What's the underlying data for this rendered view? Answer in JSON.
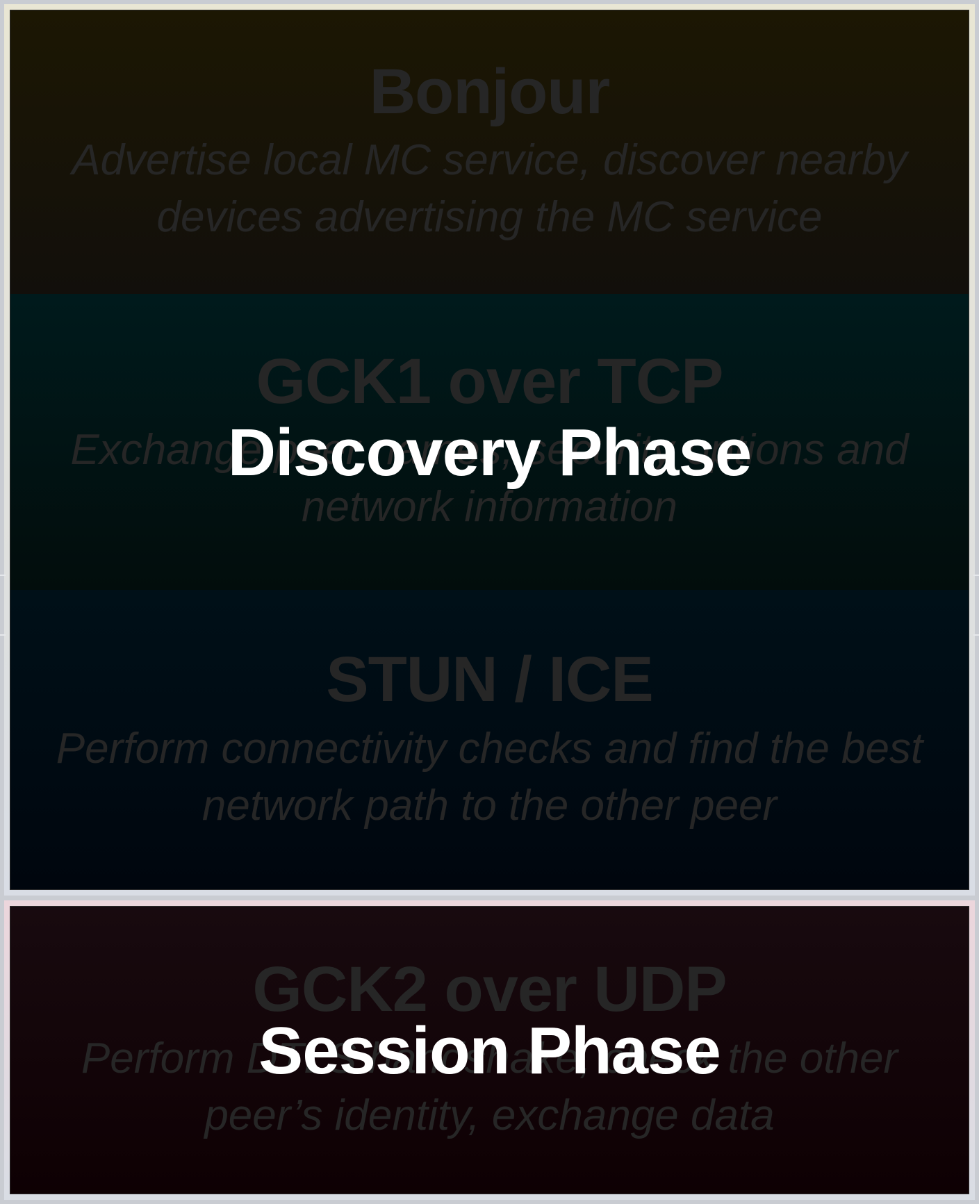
{
  "layers": {
    "bonjour": {
      "title": "Bonjour",
      "description": "Advertise local MC service, discover nearby devices advertising the MC service"
    },
    "gck1": {
      "title": "GCK1 over TCP",
      "description": "Exchange peer names, security options and network information"
    },
    "stun": {
      "title": "STUN / ICE",
      "description": "Perform connectivity checks and find the best network path to the other peer"
    },
    "gck2": {
      "title": "GCK2 over UDP",
      "description": "Perform DTLS handshake, check the other peer’s identity, exchange data"
    }
  },
  "phases": {
    "discovery": "Discovery Phase",
    "session": "Session Phase"
  },
  "colors": {
    "overlay_text": "#ffffff",
    "layer_text": "#262626",
    "bonjour_bg": "#1c1703",
    "gck1_bg": "#001a1c",
    "stun_bg": "#001018",
    "gck2_bg": "#180a0f"
  }
}
